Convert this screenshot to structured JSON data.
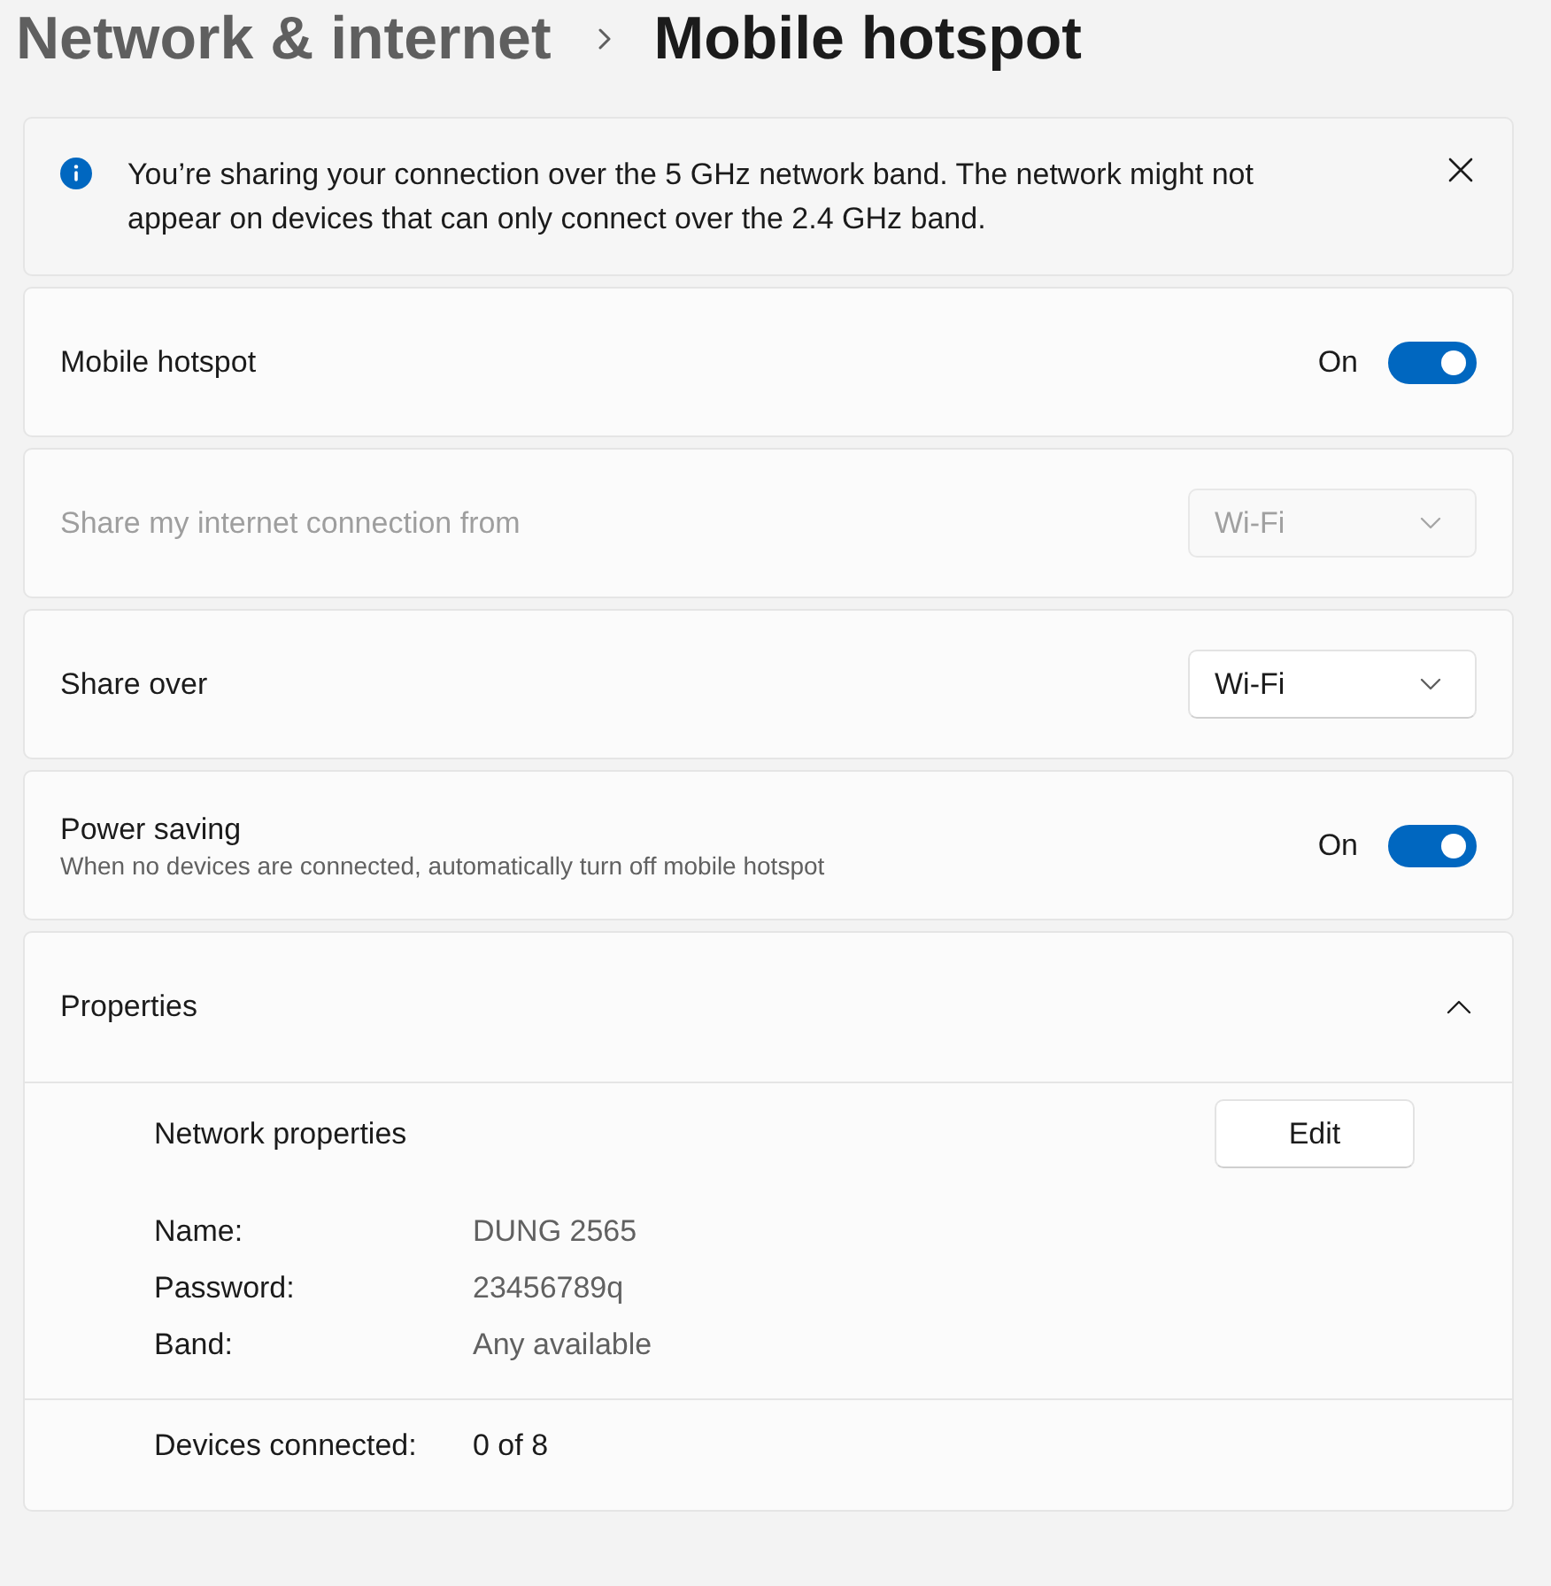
{
  "breadcrumb": {
    "parent": "Network & internet",
    "current": "Mobile hotspot"
  },
  "info_bar": {
    "message": "You’re sharing your connection over the 5 GHz network band. The network might not appear on devices that can only connect over the 2.4 GHz band."
  },
  "settings": [
    {
      "kind": "toggle",
      "label": "Mobile hotspot",
      "state_text": "On",
      "on": true,
      "disabled": false
    },
    {
      "kind": "dropdown",
      "label": "Share my internet connection from",
      "value": "Wi-Fi",
      "disabled": true
    },
    {
      "kind": "dropdown",
      "label": "Share over",
      "value": "Wi-Fi",
      "disabled": false
    },
    {
      "kind": "toggle",
      "label": "Power saving",
      "description": "When no devices are connected, automatically turn off mobile hotspot",
      "state_text": "On",
      "on": true,
      "disabled": false
    }
  ],
  "properties": {
    "title": "Properties",
    "expanded": true,
    "section_title": "Network properties",
    "edit_button": "Edit",
    "fields": [
      {
        "label": "Name:",
        "value": "DUNG 2565"
      },
      {
        "label": "Password:",
        "value": "23456789q"
      },
      {
        "label": "Band:",
        "value": "Any available"
      }
    ],
    "devices": {
      "label": "Devices connected:",
      "value": "0 of 8"
    }
  }
}
